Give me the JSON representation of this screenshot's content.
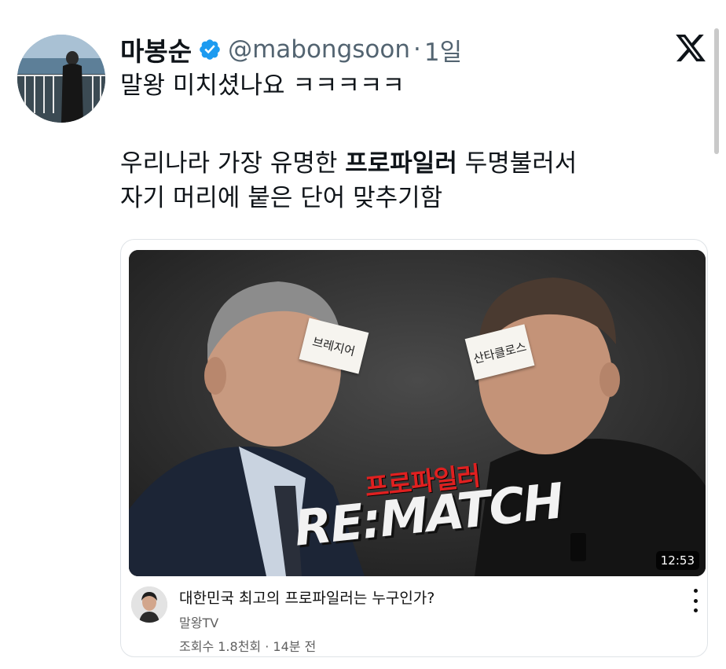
{
  "tweet": {
    "author_name": "마봉순",
    "handle": "@mabongsoon",
    "separator": "·",
    "time_ago": "1일",
    "line1": "말왕 미치셨나요 ㅋㅋㅋㅋㅋ",
    "line2_before": "우리나라 가장 유명한 ",
    "line2_bold": "프로파일러",
    "line2_after": " 두명불러서",
    "line3": "자기 머리에 붙은 단어 맞추기함"
  },
  "video": {
    "thumbnail_title_kr": "프로파일러",
    "thumbnail_title_en": "RE:MATCH",
    "note_left": "브레지어",
    "note_right": "산타클로스",
    "duration": "12:53",
    "title": "대한민국 최고의 프로파일러는 누구인가?",
    "channel": "말왕TV",
    "meta": "조회수 1.8천회 · 14분 전"
  },
  "colors": {
    "verified_blue": "#1d9bf0",
    "secondary_text": "#536471",
    "thumbnail_red": "#e02020"
  },
  "icons": {
    "verified": "verified-badge-icon",
    "x_logo": "x-logo-icon",
    "more": "more-vertical-icon"
  }
}
